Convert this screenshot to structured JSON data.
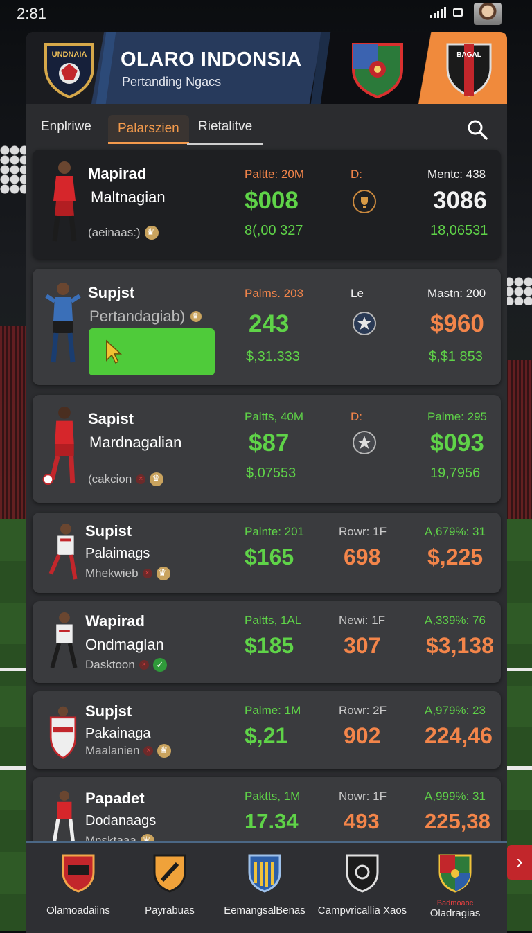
{
  "status_bar": {
    "time": "2:81"
  },
  "header": {
    "title": "OLARO INDONSIA",
    "subtitle": "Pertanding Ngacs",
    "logo_text": "UNDNAIA",
    "crest_b_text": "BAGAL"
  },
  "tabs": [
    {
      "label": "Enplriwe"
    },
    {
      "label": "Palarszien",
      "active": true
    },
    {
      "label": "Rietalitve"
    }
  ],
  "players": [
    {
      "name1": "Mapirad",
      "name2": "Maltnagian",
      "name3": "(aeinaas:)",
      "col1_label": "Paltte: 20M",
      "col1_big": "$008",
      "col1_sub": "8(,00 327",
      "col2_label": "D:",
      "col2_icon": "trophy-icon",
      "col3_label": "Mentc: 438",
      "col3_big": "3086",
      "col3_sub": "18,06531"
    },
    {
      "name1": "Supjst",
      "name2": "Pertandagiab)",
      "name3": "",
      "col1_label": "Palms. 203",
      "col1_big": "243",
      "col1_sub": "$,31.333",
      "col2_label": "Le",
      "col2_icon": "star-icon",
      "col3_label": "Mastn: 200",
      "col3_big": "$960",
      "col3_sub": "$,$1 853"
    },
    {
      "name1": "Sapist",
      "name2": "Mardnagalian",
      "name3": "(cakcion",
      "col1_label": "Paltts, 40M",
      "col1_big": "$87",
      "col1_sub": "$,07553",
      "col2_label": "D:",
      "col2_icon": "star-icon",
      "col3_label": "Palme: 295",
      "col3_big": "$093",
      "col3_sub": "19,7956"
    },
    {
      "name1": "Supist",
      "name2": "Palaimags",
      "name3": "Mhekwieb",
      "col1_label": "Palnte: 201",
      "col1_big": "$165",
      "col1_sub": "",
      "col2_label": "Rowr: 1F",
      "col2_big": "698",
      "col3_label": "A,679%: 31",
      "col3_big": "$,225",
      "col3_sub": ""
    },
    {
      "name1": "Wapirad",
      "name2": "Ondmaglan",
      "name3": "Dasktoon",
      "col1_label": "Paltts, 1AL",
      "col1_big": "$185",
      "col1_sub": "",
      "col2_label": "Newi: 1F",
      "col2_big": "307",
      "col3_label": "A,339%: 76",
      "col3_big": "$3,138",
      "col3_sub": ""
    },
    {
      "name1": "Supjst",
      "name2": "Pakainaga",
      "name3": "Maalanien",
      "col1_label": "Palme: 1M",
      "col1_big": "$,21",
      "col1_sub": "",
      "col2_label": "Rowr: 2F",
      "col2_big": "902",
      "col3_label": "A,979%: 23",
      "col3_big": "224,46",
      "col3_sub": ""
    },
    {
      "name1": "Papadet",
      "name2": "Dodanaags",
      "name3": "Mnsktaaa",
      "col1_label": "Paktts, 1M",
      "col1_big": "17.34",
      "col1_sub": "",
      "col2_label": "Nowr: 1F",
      "col2_big": "493",
      "col3_label": "A,999%: 31",
      "col3_big": "225,38",
      "col3_sub": ""
    }
  ],
  "bottom_nav": [
    {
      "label": "Olamoadaiins"
    },
    {
      "label": "Payrabuas"
    },
    {
      "label": "EemangsalBenas"
    },
    {
      "label": "Campvricallia Xaos"
    },
    {
      "label": "Oladragias",
      "badge": "Badmoaoc"
    }
  ],
  "colors": {
    "accent_orange": "#f39a4c",
    "value_green": "#5fd348",
    "value_orange": "#f3854a",
    "cta_green": "#4fcb3a",
    "header_blue": "#273a5c"
  }
}
